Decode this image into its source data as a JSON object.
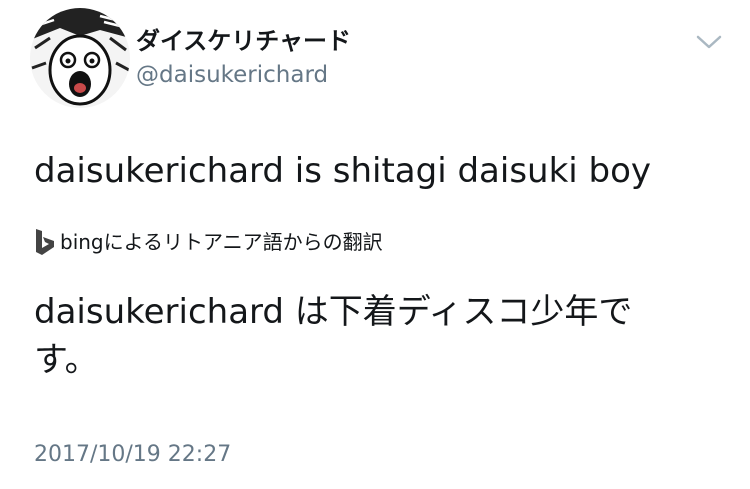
{
  "tweet": {
    "display_name": "ダイスケリチャード",
    "handle": "@daisukerichard",
    "text": "daisukerichard  is shitagi daisuki boy",
    "translation_label": "bingによるリトアニア語からの翻訳",
    "translated_text": "daisukerichard は下着ディスコ少年です。",
    "timestamp": "2017/10/19 22:27"
  },
  "icons": {
    "menu": "chevron-down-icon",
    "translator": "bing-logo-icon",
    "avatar": "manga-face-avatar"
  },
  "colors": {
    "text": "#14171a",
    "secondary": "#657786",
    "chevron": "#aab8c2"
  }
}
